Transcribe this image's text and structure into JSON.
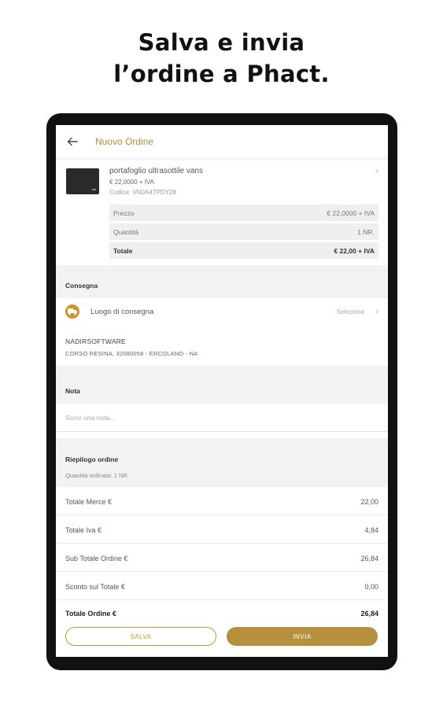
{
  "headline": {
    "line1": "Salva e invia",
    "line2": "l’ordine a Phact."
  },
  "appbar": {
    "title": "Nuovo Ordine",
    "back_icon": "arrow-left-icon"
  },
  "product": {
    "name": "portafoglio ultrasottile vans",
    "price": "€ 22,0000 + IVA",
    "code": "Codice: VN0A4TPDY28",
    "rows": [
      {
        "label": "Prezzo",
        "value": "€ 22,0000 + IVA"
      },
      {
        "label": "Quantità",
        "value": "1 NR."
      },
      {
        "label": "Totale",
        "value": "€ 22,00 + IVA"
      }
    ]
  },
  "consegna": {
    "header": "Consegna",
    "label": "Luogo di consegna",
    "select": "Seleziona",
    "icon": "truck-icon",
    "address_name": "NADIRSOFTWARE",
    "address_street": "CORSO RESINA, 32080058 - ERCOLANO - NA"
  },
  "nota": {
    "header": "Nota",
    "placeholder": "Scrivi una nota..."
  },
  "riepilogo": {
    "header": "Riepilogo ordine",
    "quantity": "Quantità ordinata: 1 NR.",
    "rows": [
      {
        "label": "Totale Merce €",
        "value": "22,00"
      },
      {
        "label": "Totale Iva €",
        "value": "4,84"
      },
      {
        "label": "Sub Totale Ordine €",
        "value": "26,84"
      },
      {
        "label": "Sconto sul Totale €",
        "value": "0,00"
      }
    ],
    "total": {
      "label": "Totale Ordine €",
      "value": "26,84"
    }
  },
  "buttons": {
    "salva": "SALVA",
    "invia": "INVIA"
  },
  "colors": {
    "accent": "#b7903e",
    "title": "#b78a3c"
  }
}
